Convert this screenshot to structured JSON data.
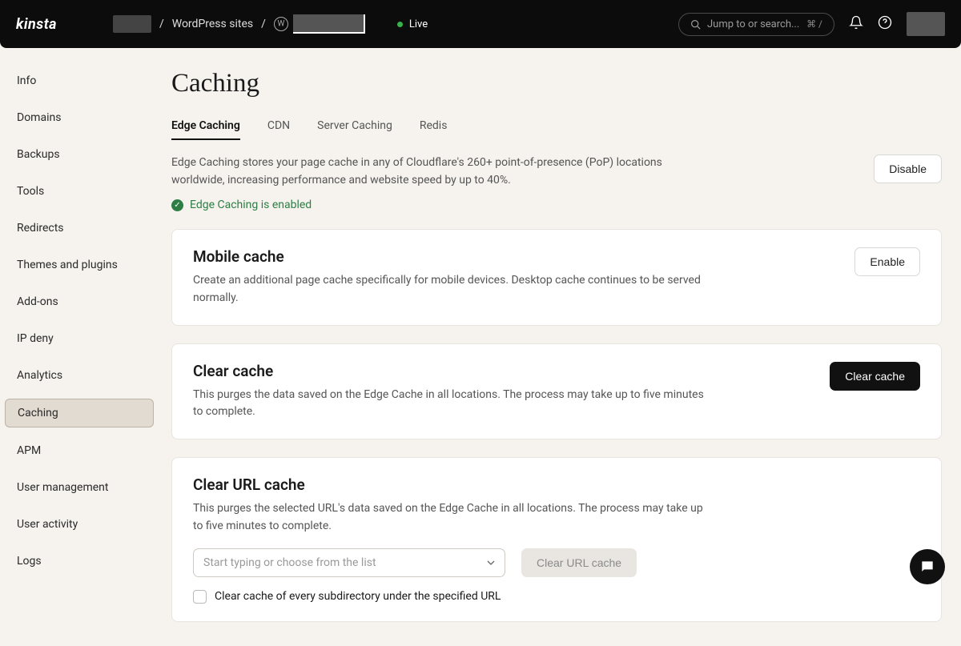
{
  "header": {
    "brand": "kinsta",
    "breadcrumb_sep": "/",
    "wp_sites_label": "WordPress sites",
    "live_label": "Live",
    "search_placeholder": "Jump to or search...",
    "search_shortcut": "⌘ /"
  },
  "sidebar": {
    "items": [
      {
        "label": "Info"
      },
      {
        "label": "Domains"
      },
      {
        "label": "Backups"
      },
      {
        "label": "Tools"
      },
      {
        "label": "Redirects"
      },
      {
        "label": "Themes and plugins"
      },
      {
        "label": "Add-ons"
      },
      {
        "label": "IP deny"
      },
      {
        "label": "Analytics"
      },
      {
        "label": "Caching"
      },
      {
        "label": "APM"
      },
      {
        "label": "User management"
      },
      {
        "label": "User activity"
      },
      {
        "label": "Logs"
      }
    ],
    "active_index": 9
  },
  "page": {
    "title": "Caching",
    "tabs": [
      {
        "label": "Edge Caching"
      },
      {
        "label": "CDN"
      },
      {
        "label": "Server Caching"
      },
      {
        "label": "Redis"
      }
    ],
    "active_tab_index": 0,
    "tab_description": "Edge Caching stores your page cache in any of Cloudflare's 260+ point-of-presence (PoP) locations worldwide, increasing performance and website speed by up to 40%.",
    "status_text": "Edge Caching is enabled",
    "disable_btn": "Disable",
    "cards": {
      "mobile": {
        "title": "Mobile cache",
        "desc": "Create an additional page cache specifically for mobile devices. Desktop cache continues to be served normally.",
        "btn": "Enable"
      },
      "clear": {
        "title": "Clear cache",
        "desc": "This purges the data saved on the Edge Cache in all locations. The process may take up to five minutes to complete.",
        "btn": "Clear cache"
      },
      "clear_url": {
        "title": "Clear URL cache",
        "desc": "This purges the selected URL's data saved on the Edge Cache in all locations. The process may take up to five minutes to complete.",
        "placeholder": "Start typing or choose from the list",
        "btn": "Clear URL cache",
        "checkbox_label": "Clear cache of every subdirectory under the specified URL"
      }
    }
  }
}
